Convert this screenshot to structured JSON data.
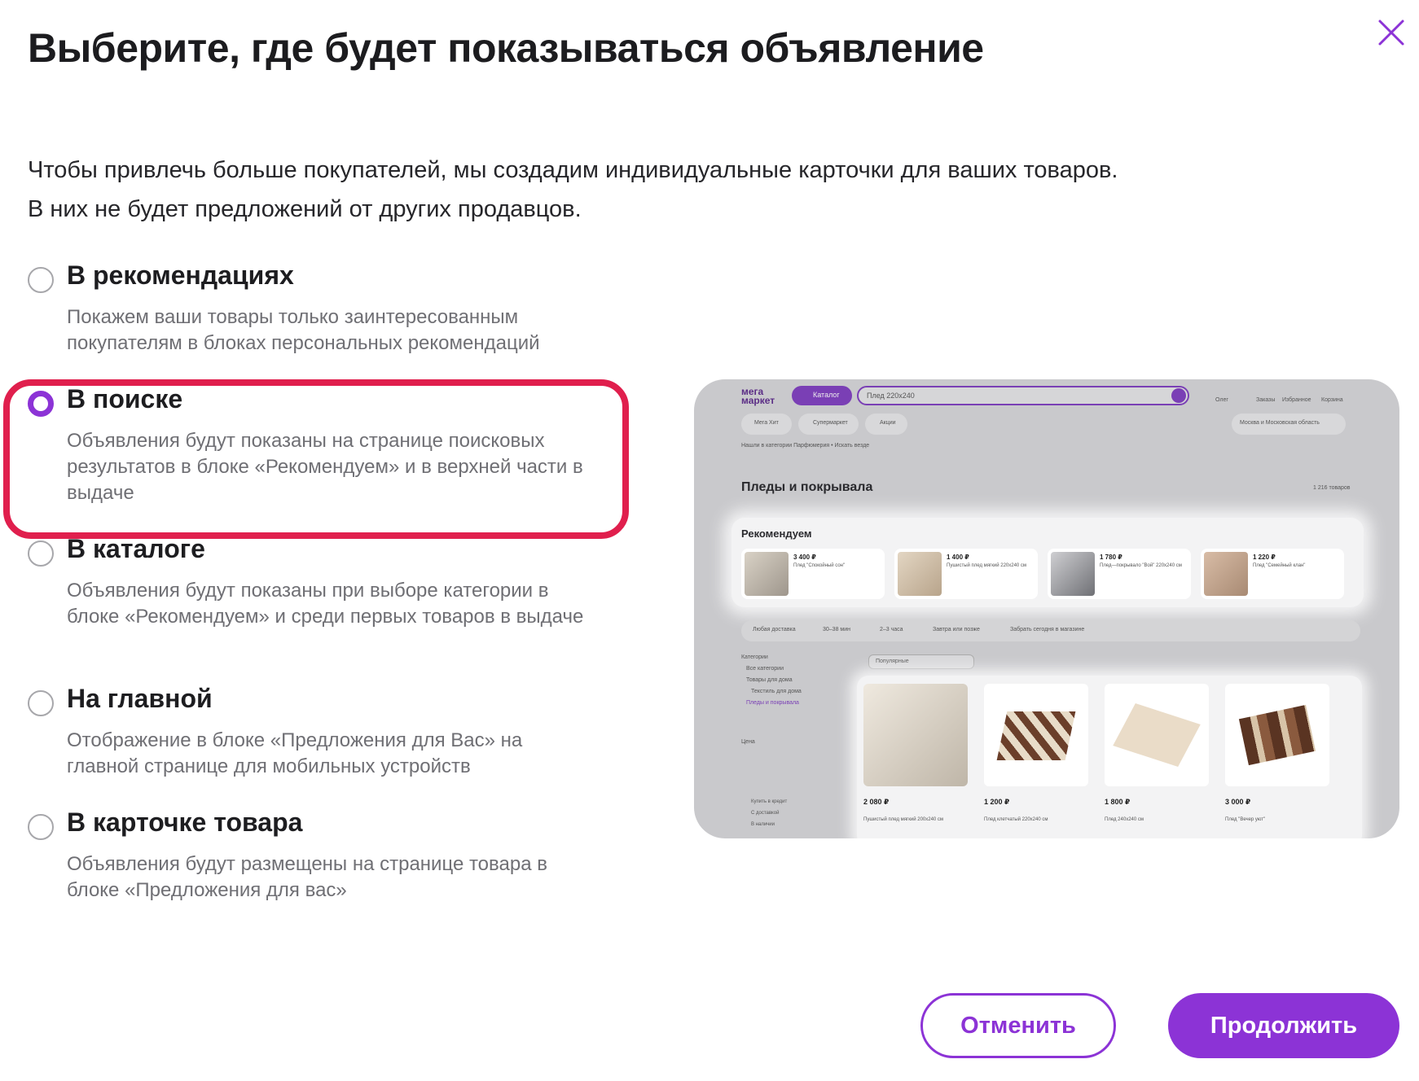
{
  "dialog": {
    "title": "Выберите, где будет показываться объявление",
    "description_line1": "Чтобы привлечь больше покупателей, мы создадим индивидуальные карточки для ваших товаров.",
    "description_line2": "В них не будет предложений от других продавцов."
  },
  "options": [
    {
      "title": "В рекомендациях",
      "desc": "Покажем ваши товары только заинтересованным покупателям в блоках персональных рекомендаций",
      "selected": false
    },
    {
      "title": "В поиске",
      "desc": "Объявления будут показаны на странице поисковых результатов в блоке «Рекомендуем» и в верхней части в выдаче",
      "selected": true
    },
    {
      "title": "В каталоге",
      "desc": "Объявления будут показаны при выборе категории в блоке «Рекомендуем» и среди первых товаров в выдаче",
      "selected": false
    },
    {
      "title": "На главной",
      "desc": "Отображение в блоке «Предложения для Вас» на главной странице для мобильных устройств",
      "selected": false
    },
    {
      "title": "В карточке товара",
      "desc": "Объявления будут размещены на странице товара в блоке «Предложения для вас»",
      "selected": false
    }
  ],
  "preview": {
    "logo": "мега маркет",
    "catalog_button": "Каталог",
    "search_value": "Плед 220x240",
    "header_icons": [
      "Олег",
      "Заказы",
      "Избранное",
      "Корзина"
    ],
    "chips": [
      "Мега Хит",
      "Супермаркет",
      "Акции"
    ],
    "region": "Москва и Московская область",
    "hint": "Нашли в категории Парфюмерия • Искать везде",
    "page_title": "Пледы и покрывала",
    "count": "1 216 товаров",
    "recommend_title": "Рекомендуем",
    "recommend_items": [
      {
        "price": "3 400 ₽",
        "name": "Плед \"Спокойный сон\""
      },
      {
        "price": "1 400 ₽",
        "name": "Пушистый плед мягкий 220x240 см"
      },
      {
        "price": "1 780 ₽",
        "name": "Плед—покрывало \"Вой\" 220x240 см"
      },
      {
        "price": "1 220 ₽",
        "name": "Плед \"Семейный клан\""
      }
    ],
    "filters": [
      "Любая доставка",
      "30–38 мин",
      "2–3 часа",
      "Завтра или позже",
      "Забрать сегодня в магазине"
    ],
    "sort": "Популярные",
    "sidebar": [
      "Категории",
      "Все категории",
      "Товары для дома",
      "Текстиль для дома",
      "Пледы и покрывала",
      "Цена",
      "Купить в кредит",
      "С доставкой",
      "В наличии"
    ],
    "product_prices": [
      "2 080 ₽",
      "1 200 ₽",
      "1 800 ₽",
      "3 000 ₽"
    ],
    "product_names": [
      "Пушистый плед мягкий 200x240 см",
      "Плед клетчатый 220x240 см",
      "Плед 240x240 см",
      "Плед \"Вечер уют\""
    ]
  },
  "buttons": {
    "cancel": "Отменить",
    "continue": "Продолжить"
  },
  "colors": {
    "accent": "#8c33d6",
    "highlight": "#e01f4d"
  }
}
